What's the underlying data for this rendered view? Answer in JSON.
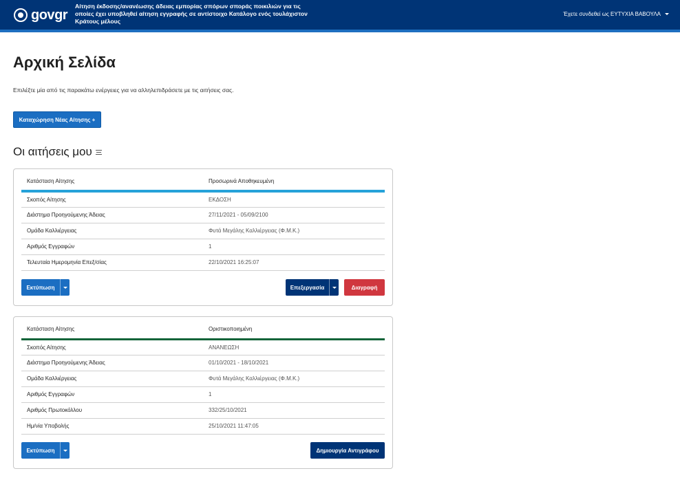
{
  "header": {
    "logo_text_gov": "gov",
    "logo_text_gr": "gr",
    "title": "Αίτηση έκδοσης/ανανέωσης άδειας εμπορίας σπόρων σποράς ποικιλιών για τις οποίες έχει υποβληθεί αίτηση εγγραφής σε αντίστοιχο Κατάλογο ενός τουλάχιστον Κράτους μέλους",
    "user_label": "Έχετε συνδεθεί ως ΕΥΤΥΧΙΑ ΒΑΒΟΥΛΑ"
  },
  "main": {
    "title": "Αρχική Σελίδα",
    "description": "Επιλέξτε μία από τις παρακάτω ενέργειες για να αλληλεπιδράσετε με τις αιτήσεις σας.",
    "new_button": "Καταχώρηση Νέας Αίτησης +",
    "section_title": "Οι αιτήσεις μου"
  },
  "applications": [
    {
      "status_label": "Κατάσταση Αίτησης",
      "status_value": "Προσωρινά Αποθηκευμένη",
      "rows": [
        {
          "label": "Σκοπός Αίτησης",
          "value": "ΕΚΔΟΣΗ"
        },
        {
          "label": "Διάστημα Προηγούμενης Άδειας",
          "value": "27/11/2021 - 05/09/2100"
        },
        {
          "label": "Ομάδα Καλλιέργειας",
          "value": "Φυτά Μεγάλης Καλλιέργειας (Φ.Μ.Κ.)"
        },
        {
          "label": "Αριθμός Εγγραφών",
          "value": "1"
        },
        {
          "label": "Τελευταία Ημερομηνία Επεξ/σίας",
          "value": "22/10/2021 16:25:07"
        }
      ],
      "print_button": "Εκτύπωση",
      "edit_button": "Επεξεργασία",
      "delete_button": "Διαγραφή"
    },
    {
      "status_label": "Κατάσταση Αίτησης",
      "status_value": "Οριστικοποιημένη",
      "rows": [
        {
          "label": "Σκοπός Αίτησης",
          "value": "ΑΝΑΝΕΩΣΗ"
        },
        {
          "label": "Διάστημα Προηγούμενης Άδειας",
          "value": "01/10/2021 - 18/10/2021"
        },
        {
          "label": "Ομάδα Καλλιέργειας",
          "value": "Φυτά Μεγάλης Καλλιέργειας (Φ.Μ.Κ.)"
        },
        {
          "label": "Αριθμός Εγγραφών",
          "value": "1"
        },
        {
          "label": "Αριθμός Πρωτοκόλλου",
          "value": "332/25/10/2021"
        },
        {
          "label": "Ημ/νία Υποβολής",
          "value": "25/10/2021 11:47:05"
        }
      ],
      "print_button": "Εκτύπωση",
      "copy_button": "Δημιουργία Αντιγράφου"
    }
  ],
  "colors": {
    "header_bg": "#003476",
    "primary": "#1b6ec2",
    "danger": "#d0373f",
    "status_draft": "#26a2d9",
    "status_final": "#116338"
  }
}
